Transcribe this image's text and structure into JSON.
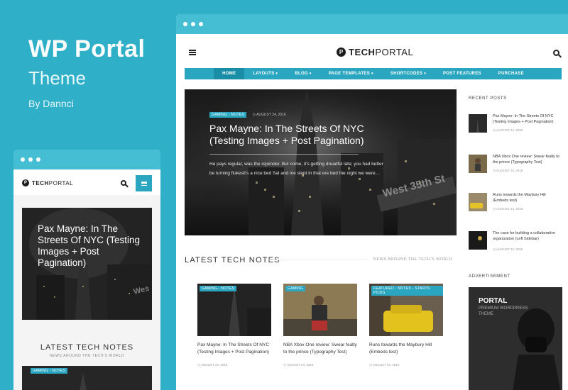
{
  "hero": {
    "title": "WP Portal",
    "subtitle": "Theme",
    "byline": "By Dannci"
  },
  "site": {
    "logo_mark": "P",
    "logo_strong": "TECH",
    "logo_rest": "PORTAL"
  },
  "nav": [
    {
      "label": "Home",
      "dropdown": false,
      "active": true
    },
    {
      "label": "Layouts",
      "dropdown": true
    },
    {
      "label": "Blog",
      "dropdown": true
    },
    {
      "label": "Page Templates",
      "dropdown": true
    },
    {
      "label": "Shortcodes",
      "dropdown": true
    },
    {
      "label": "Post Features",
      "dropdown": false
    },
    {
      "label": "Purchase",
      "dropdown": false
    }
  ],
  "featured": {
    "tag": "Gaming - Notes",
    "date": "August 24, 2016",
    "title": "Pax Mayne: In The Streets Of NYC (Testing Images + Post Pagination)",
    "excerpt": "He pays regular, was the rejoinder. But come, it's getting dreadful late; you had better be turning flukesit's a nice bed Sal and me slept in that ere bed the night we were…",
    "sign_text": "West 35th St"
  },
  "sidebar": {
    "recent_heading": "Recent Posts",
    "recent": [
      {
        "title": "Pax Mayne: In The Streets Of NYC (Testing Images + Post Pagination)",
        "date": "August 24, 2016"
      },
      {
        "title": "NBA Xbox One review: Swear fealty to the prince (Typography Test)",
        "date": "August 24, 2016"
      },
      {
        "title": "Runs towards the Maybury Hill (Embeds test)",
        "date": "August 24, 2016"
      },
      {
        "title": "The case for building a collaborative organization (Left Sidebar)",
        "date": "August 22, 2016"
      }
    ],
    "ad_heading": "Advertisement",
    "ad_title": "Portal",
    "ad_sub": "Premium WordPress Theme"
  },
  "latest": {
    "heading": "LATEST TECH NOTES",
    "sub": "News around the tech's world",
    "cards": [
      {
        "tag": "Gaming - Notes",
        "title": "Pax Mayne: In The Streets Of NYC (Testing Images + Post Pagination)",
        "date": "August 24, 2016"
      },
      {
        "tag": "Gaming",
        "title": "NBA Xbox One review: Swear fealty to the prince (Typography Test)",
        "date": "August 24, 2016"
      },
      {
        "tag": "Featured - Notes - Starts Picks",
        "title": "Runs towards the Maybury Hill (Embeds test)",
        "date": "August 24, 2016"
      }
    ]
  },
  "mobile": {
    "featured_title": "Pax Mayne: In The Streets Of NYC (Testing Images + Post Pagination)",
    "latest_heading": "LATEST TECH NOTES",
    "latest_sub": "News around the tech's world",
    "card_tag": "Gaming - Notes"
  },
  "colors": {
    "brand": "#2fb0c8",
    "accent": "#2aa6c1",
    "bar": "#45bdd3"
  }
}
